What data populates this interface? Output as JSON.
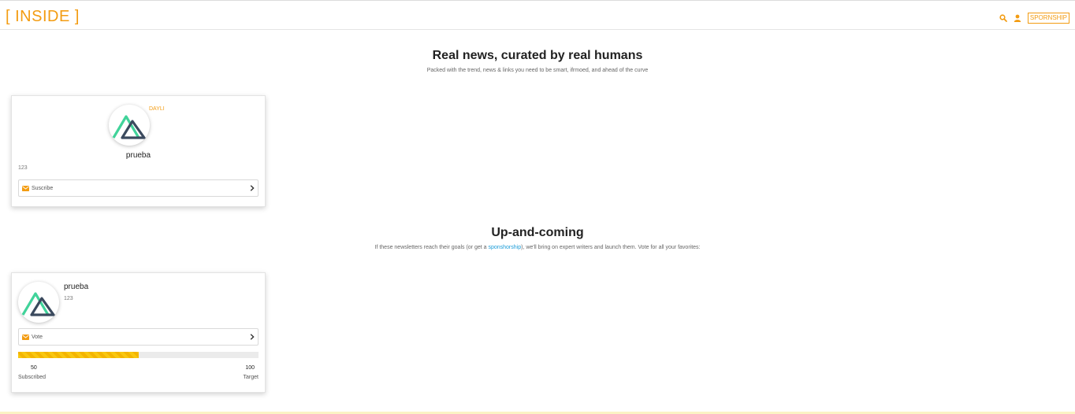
{
  "navbar": {
    "brand": "[ INSIDE ]",
    "search_icon": "search-icon",
    "user_icon": "user-icon",
    "sponsorship_label": "SPORNSHIP",
    "accent": "#f39c12"
  },
  "hero": {
    "title": "Real news, curated by real humans",
    "subtitle": "Packed with the trend, news & links you need to be smart, ifrmoed, and ahead of the curve"
  },
  "featured_card": {
    "badge": "DAYLI",
    "name": "prueba",
    "count": "123",
    "action_label": "Suscribe",
    "logo_icon": "mountain-logo-icon"
  },
  "upcoming": {
    "title": "Up-and-coming",
    "subtitle_before": "If these newsletters reach their goals (or get a ",
    "subtitle_link": "sponshorship",
    "subtitle_after": "), we'll bring on expert writers and launch them. Vote for all your favorites:"
  },
  "upcoming_card": {
    "name": "prueba",
    "count": "123",
    "action_label": "Vote",
    "progress": 0.5,
    "subscribed_value": "50",
    "subscribed_label": "Subscribed",
    "target_value": "100",
    "target_label": "Target",
    "logo_icon": "mountain-logo-icon",
    "progress_color": "#f8c70f"
  }
}
